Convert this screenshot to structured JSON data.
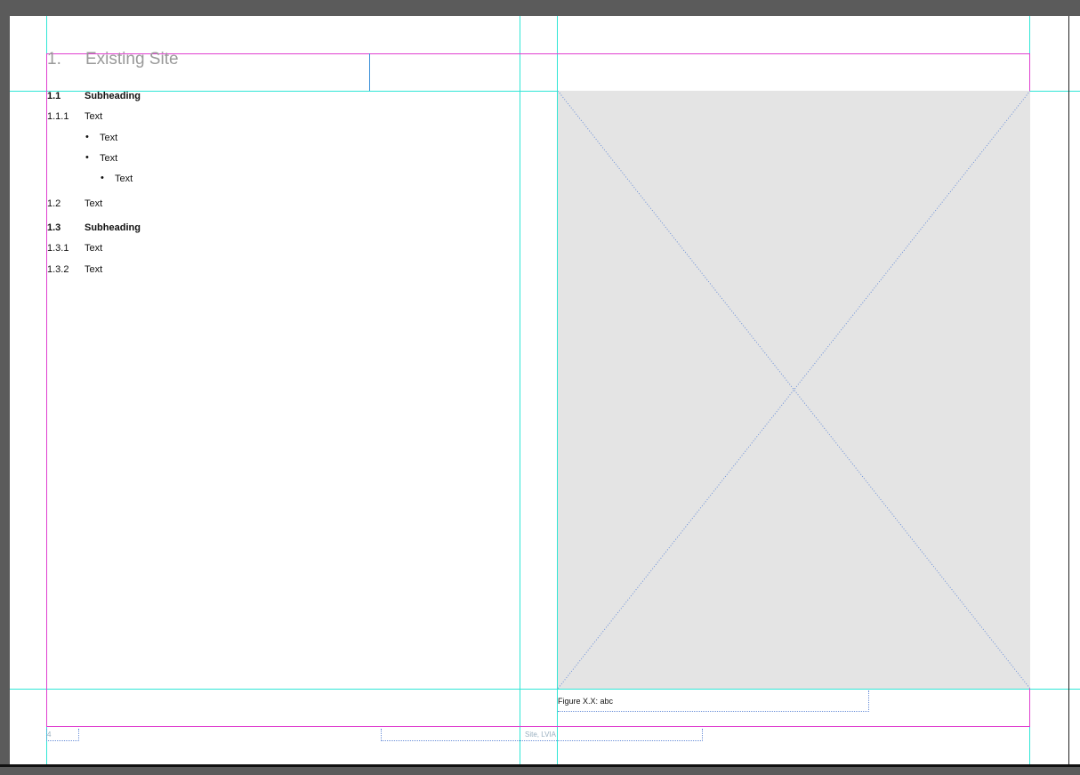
{
  "heading": {
    "number": "1.",
    "title": "Existing Site"
  },
  "sections": [
    {
      "num": "1.1",
      "text": "Subheading",
      "bold": true
    },
    {
      "num": "1.1.1",
      "text": "Text",
      "bold": false
    }
  ],
  "bullets": [
    {
      "dot": "•",
      "text": "Text"
    },
    {
      "dot": "•",
      "text": "Text"
    },
    {
      "dot": "•",
      "text": "Text"
    }
  ],
  "sections2": [
    {
      "num": "1.2",
      "text": "Text",
      "bold": false
    },
    {
      "num": "1.3",
      "text": "Subheading",
      "bold": true
    },
    {
      "num": "1.3.1",
      "text": "Text",
      "bold": false
    },
    {
      "num": "1.3.2",
      "text": "Text",
      "bold": false
    }
  ],
  "figure": {
    "caption": "Figure X.X: abc"
  },
  "footer": {
    "page_number": "4",
    "running_footer": "Site, LVIA"
  },
  "colors": {
    "pasteboard": "#5b5b5b",
    "guide": "#30e6d6",
    "margin": "#e040d0",
    "placeholder": "#e4e4e4"
  }
}
